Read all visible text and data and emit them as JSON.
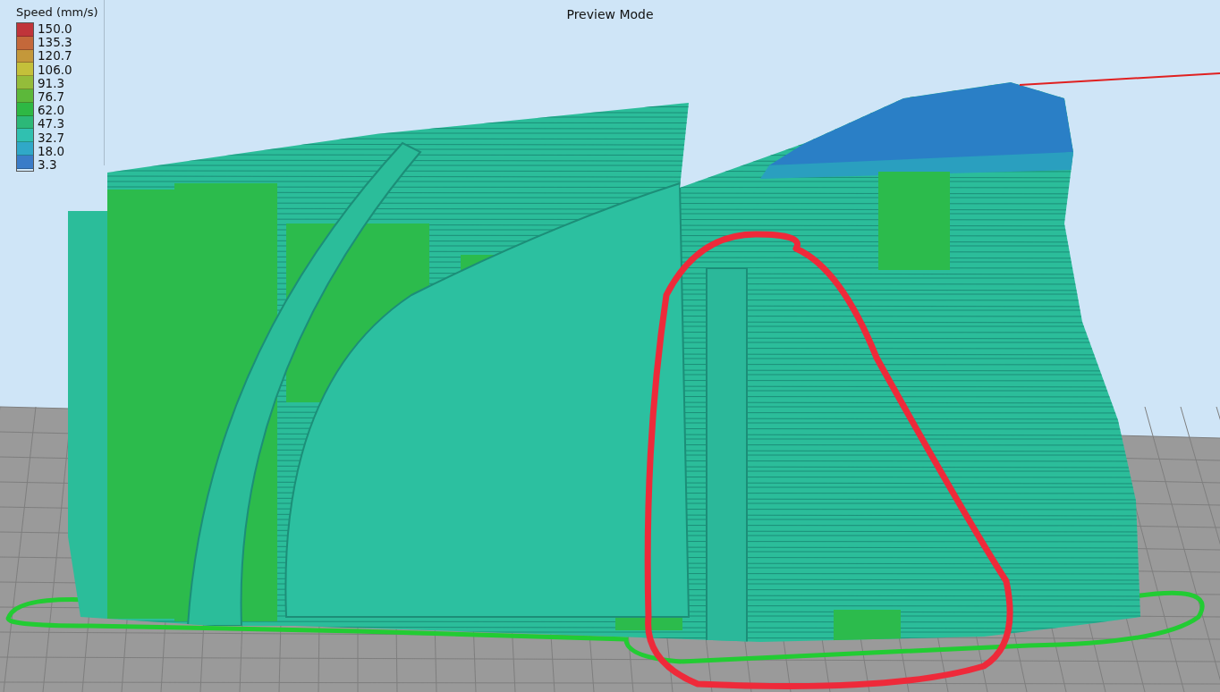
{
  "legend": {
    "title": "Speed (mm/s)",
    "items": [
      {
        "label": "150.0",
        "color": "#c0343a"
      },
      {
        "label": "135.3",
        "color": "#c4683a"
      },
      {
        "label": "120.7",
        "color": "#c4983a"
      },
      {
        "label": "106.0",
        "color": "#c4c03a"
      },
      {
        "label": "91.3",
        "color": "#94bc3a"
      },
      {
        "label": "76.7",
        "color": "#5cb83a"
      },
      {
        "label": "62.0",
        "color": "#2eb844"
      },
      {
        "label": "47.3",
        "color": "#2cb878"
      },
      {
        "label": "32.7",
        "color": "#30c0b0"
      },
      {
        "label": "18.0",
        "color": "#30a8c8"
      },
      {
        "label": "3.3",
        "color": "#3a7cc8"
      }
    ]
  },
  "viewport": {
    "title": "Preview Mode"
  }
}
